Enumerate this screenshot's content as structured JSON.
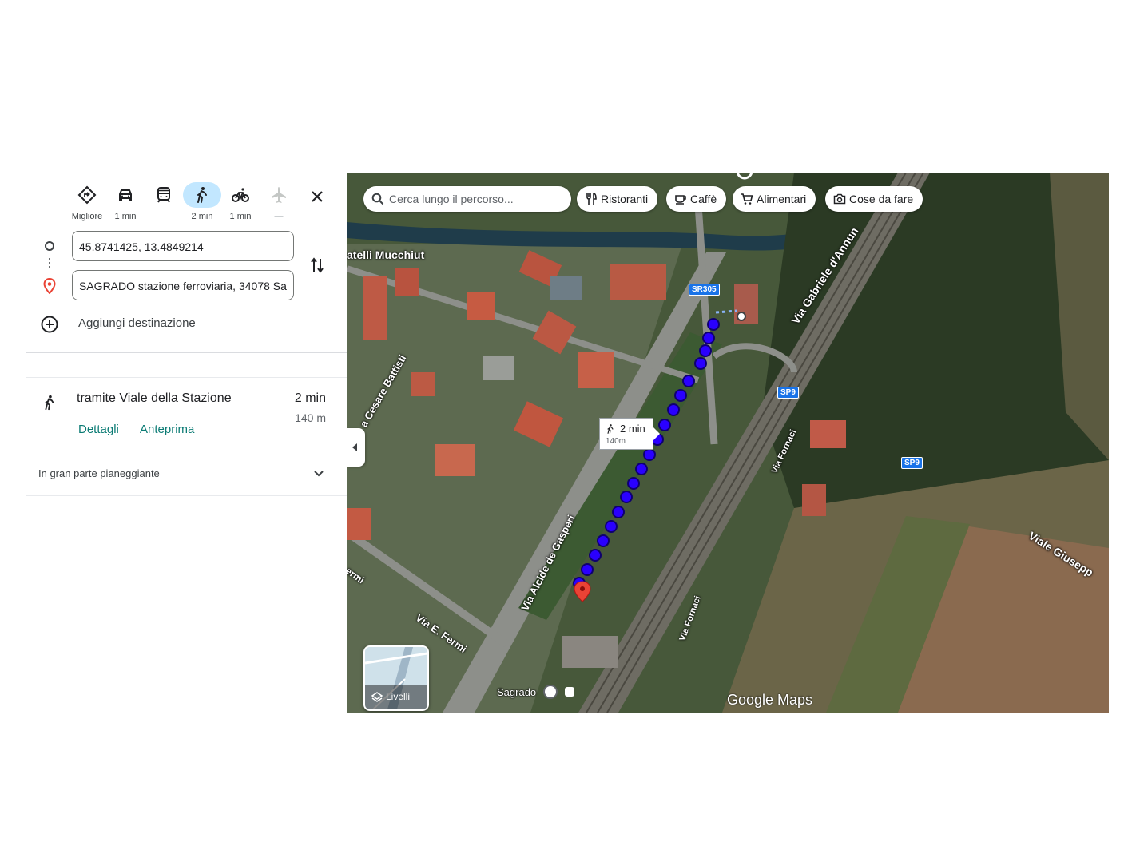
{
  "modes": [
    {
      "name": "mode-best",
      "label": "Migliore",
      "icon": "diamond-direction-icon"
    },
    {
      "name": "mode-car",
      "label": "1 min",
      "icon": "car-icon"
    },
    {
      "name": "mode-transit",
      "label": "",
      "icon": "train-icon"
    },
    {
      "name": "mode-walk",
      "label": "2 min",
      "icon": "walk-icon",
      "active": true
    },
    {
      "name": "mode-bike",
      "label": "1 min",
      "icon": "bike-icon"
    },
    {
      "name": "mode-flight",
      "label": "—",
      "icon": "plane-icon"
    }
  ],
  "origin_value": "45.8741425, 13.4849214",
  "destination_value": "SAGRADO stazione ferroviaria, 34078 Sa",
  "add_destination_label": "Aggiungi destinazione",
  "route": {
    "title": "tramite Viale della Stazione",
    "time": "2 min",
    "distance": "140 m",
    "details_label": "Dettagli",
    "preview_label": "Anteprima",
    "elevation_note": "In gran parte pianeggiante"
  },
  "map": {
    "search_placeholder": "Cerca lungo il percorso...",
    "chips": [
      "Ristoranti",
      "Caffè",
      "Alimentari",
      "Cose da fare"
    ],
    "bubble_time": "2 min",
    "bubble_distance": "140m",
    "layers_label": "Livelli",
    "brand": "Google Maps",
    "road_labels": [
      "atelli Mucchiut",
      "Via Gabriele d'Annun",
      "a Cesare Battisti",
      "Via Fornaci",
      "Via Alcide de Gasperi",
      "Via E. Fermi",
      "Viale Giusepp",
      "ermi"
    ],
    "shields": [
      "SR305",
      "SP9",
      "SP9"
    ],
    "station_label": "Sagrado",
    "colors": {
      "route_dot": "#2a00ff",
      "destination_pin": "#ea4335",
      "accent_link": "#0b7b74",
      "active_mode_bg": "#c2e7ff"
    }
  }
}
